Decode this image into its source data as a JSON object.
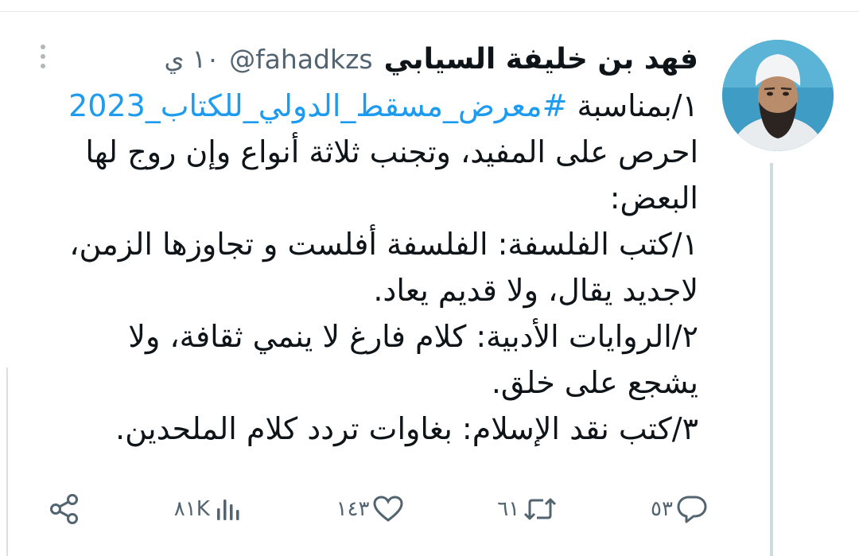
{
  "tweet": {
    "display_name": "فهد بن خليفة السيابي",
    "handle": "@fahadkzs",
    "time": "١٠ ي",
    "text_intro": "١/بمناسبة ",
    "hashtag": "#معرض_مسقط_الدولي_للكتاب_2023",
    "lines": [
      "احرص على المفيد، وتجنب ثلاثة أنواع وإن روج لها",
      "البعض:",
      "١/كتب الفلسفة: الفلسفة أفلست و تجاوزها الزمن،",
      "لاجديد يقال، ولا قديم يعاد.",
      "٢/الروايات الأدبية: كلام فارغ لا ينمي ثقافة، ولا",
      "يشجع على خلق.",
      "٣/كتب نقد الإسلام: بغاوات تردد كلام الملحدين."
    ]
  },
  "actions": {
    "views": "٨١K",
    "likes": "١٤٣",
    "retweets": "٦١",
    "replies": "٥٣"
  },
  "icons": {
    "share": "share-icon",
    "views": "bar-chart-icon",
    "likes": "heart-icon",
    "retweets": "retweet-icon",
    "replies": "reply-icon",
    "more": "more-vertical-icon"
  },
  "colors": {
    "hashtag": "#1d9bf0",
    "text": "#0f1419",
    "muted": "#536471",
    "thread_line": "#cfd9de"
  }
}
